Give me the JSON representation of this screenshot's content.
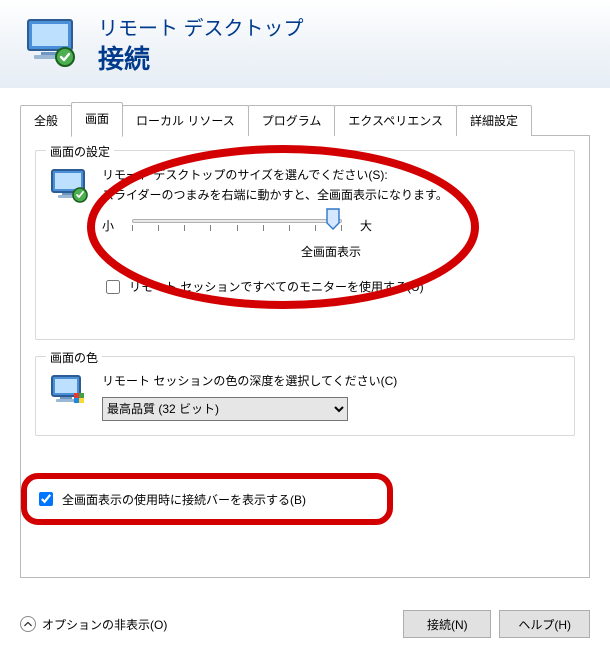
{
  "header": {
    "app": "リモート デスクトップ",
    "title": "接続"
  },
  "tabs": [
    {
      "id": "general",
      "label": "全般"
    },
    {
      "id": "display",
      "label": "画面"
    },
    {
      "id": "local",
      "label": "ローカル リソース"
    },
    {
      "id": "programs",
      "label": "プログラム"
    },
    {
      "id": "experience",
      "label": "エクスペリエンス"
    },
    {
      "id": "advanced",
      "label": "詳細設定"
    }
  ],
  "active_tab": "display",
  "display": {
    "group_title": "画面の設定",
    "desc1": "リモート デスクトップのサイズを選んでください(S):",
    "desc2": "スライダーのつまみを右端に動かすと、全画面表示になります。",
    "slider": {
      "min_label": "小",
      "max_label": "大",
      "value_label": "全画面表示"
    },
    "use_all_monitors_label": "リモート セッションですべてのモニターを使用する(U)",
    "use_all_monitors_checked": false
  },
  "color": {
    "group_title": "画面の色",
    "desc": "リモート セッションの色の深度を選択してください(C)",
    "selected": "最高品質 (32 ビット)"
  },
  "connection_bar": {
    "label": "全画面表示の使用時に接続バーを表示する(B)",
    "checked": true
  },
  "footer": {
    "options_label": "オプションの非表示(O)",
    "connect": "接続(N)",
    "help": "ヘルプ(H)"
  }
}
